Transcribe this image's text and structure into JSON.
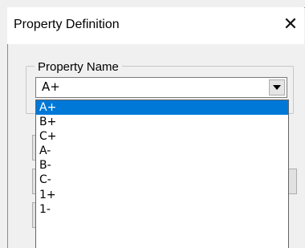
{
  "window": {
    "title": "Property Definition",
    "close_glyph": "✕"
  },
  "group": {
    "legend": "Property Name"
  },
  "combo": {
    "value": "A+"
  },
  "dropdown": {
    "options": [
      "A+",
      "B+",
      "C+",
      "A-",
      "B-",
      "C-",
      "1+",
      "1-"
    ],
    "selected_index": 0
  },
  "colors": {
    "selection": "#0078d7",
    "titlebar": "#ffffff",
    "dialog": "#f0f0f0"
  }
}
